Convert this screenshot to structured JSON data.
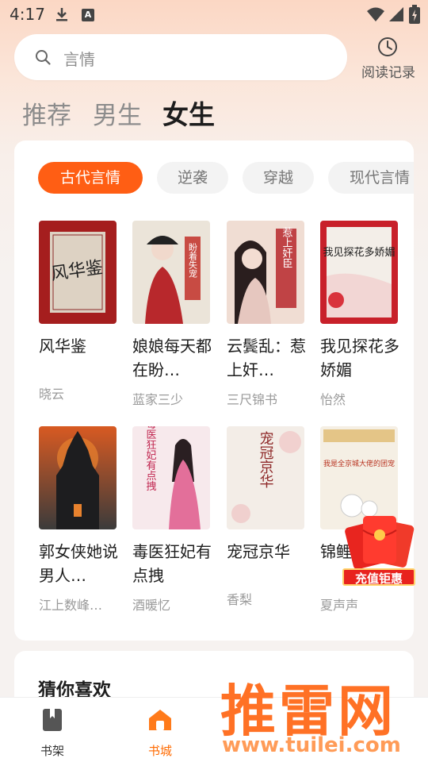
{
  "status_bar": {
    "time": "4:17",
    "notification_letter": "A"
  },
  "search": {
    "placeholder": "言情"
  },
  "history": {
    "label": "阅读记录"
  },
  "gender_tabs": [
    {
      "label": "推荐",
      "active": false
    },
    {
      "label": "男生",
      "active": false
    },
    {
      "label": "女生",
      "active": true
    }
  ],
  "categories": [
    {
      "label": "古代言情",
      "active": true
    },
    {
      "label": "逆袭",
      "active": false
    },
    {
      "label": "穿越",
      "active": false
    },
    {
      "label": "现代言情",
      "active": false
    }
  ],
  "books": [
    {
      "title": "风华鉴",
      "author": "晓云",
      "cover_text": "风华鉴",
      "colors": [
        "#a31d1d",
        "#d9cfc1"
      ]
    },
    {
      "title": "娘娘每天都在盼…",
      "author": "蓝家三少",
      "cover_text": "盼着失宠",
      "colors": [
        "#e9e3da",
        "#b4272b"
      ]
    },
    {
      "title": "云鬓乱：惹上奸…",
      "author": "三尺锦书",
      "cover_text": "惹上奸臣",
      "colors": [
        "#f1dfd6",
        "#b7282b"
      ]
    },
    {
      "title": "我见探花多娇媚",
      "author": "怡然",
      "cover_text": "我见探花多娇媚",
      "colors": [
        "#c8202a",
        "#f3eee8"
      ]
    },
    {
      "title": "郭女侠她说男人…",
      "author": "江上数峰…",
      "cover_text": "",
      "colors": [
        "#2b2c2e",
        "#e2762d"
      ]
    },
    {
      "title": "毒医狂妃有点拽",
      "author": "酒暖忆",
      "cover_text": "毒医狂妃有点拽",
      "colors": [
        "#f6e7ea",
        "#d63e74"
      ]
    },
    {
      "title": "宠冠京华",
      "author": "香梨",
      "cover_text": "宠冠京华",
      "colors": [
        "#f2ece6",
        "#9a2d2d"
      ]
    },
    {
      "title": "锦鲤三岁",
      "author": "夏声声",
      "cover_text": "我是全京城大佬的团宠",
      "colors": [
        "#f5efe4",
        "#c0862a"
      ]
    }
  ],
  "promo": {
    "label": "充值钜惠"
  },
  "guess": {
    "title": "猜你喜欢"
  },
  "bottom_nav": [
    {
      "label": "书架",
      "icon": "book-icon",
      "active": false
    },
    {
      "label": "书城",
      "icon": "store-icon",
      "active": true
    }
  ],
  "watermark": {
    "brand": "推雷网",
    "url": "www.tuilei.com"
  },
  "colors": {
    "accent": "#ff5e14",
    "nav_active": "#ff6a00"
  }
}
